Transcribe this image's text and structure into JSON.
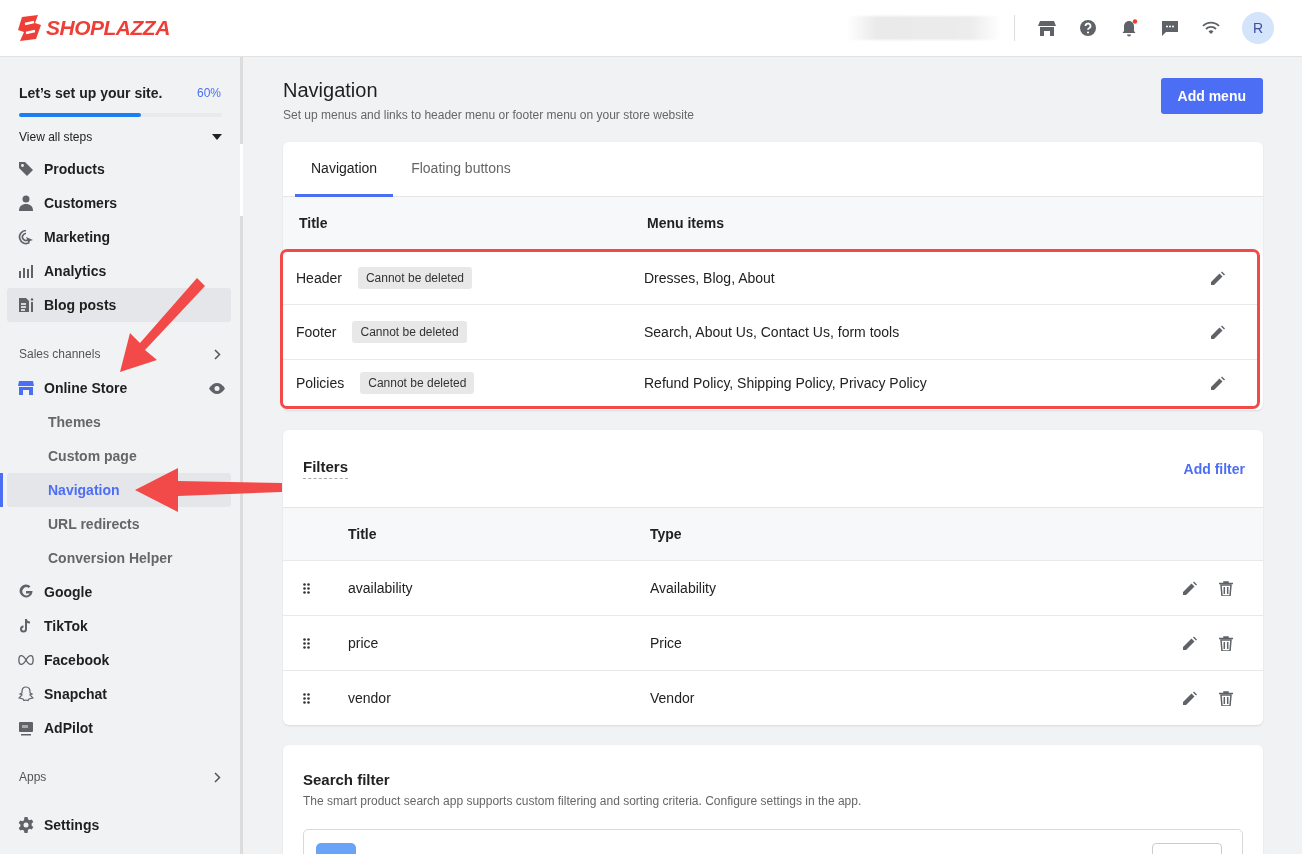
{
  "topbar": {
    "brand": "SHOPLAZZA",
    "notification_unread": true,
    "avatar": "R"
  },
  "sidebar": {
    "setup": {
      "title": "Let’s set up your site.",
      "percent": "60%",
      "level": 0.6,
      "toggle": "View all steps"
    },
    "items": [
      {
        "label": "Products",
        "kind": "main",
        "selected": false,
        "highlighted": false
      },
      {
        "label": "Customers",
        "kind": "main",
        "selected": false,
        "highlighted": false
      },
      {
        "label": "Marketing",
        "kind": "main",
        "selected": false,
        "highlighted": false
      },
      {
        "label": "Analytics",
        "kind": "main",
        "selected": false,
        "highlighted": false
      },
      {
        "label": "Blog posts",
        "kind": "main",
        "selected": false,
        "highlighted": true
      },
      {
        "label": "Sales channels",
        "kind": "section",
        "selected": false,
        "highlighted": false
      },
      {
        "label": "Online Store",
        "kind": "main",
        "selected": false,
        "highlighted": false
      },
      {
        "label": "Themes",
        "kind": "sub",
        "selected": false,
        "highlighted": false
      },
      {
        "label": "Custom page",
        "kind": "sub",
        "selected": false,
        "highlighted": false
      },
      {
        "label": "Navigation",
        "kind": "sub",
        "selected": true,
        "highlighted": true
      },
      {
        "label": "URL redirects",
        "kind": "sub",
        "selected": false,
        "highlighted": false
      },
      {
        "label": "Conversion Helper",
        "kind": "sub",
        "selected": false,
        "highlighted": false
      },
      {
        "label": "Google",
        "kind": "main",
        "selected": false,
        "highlighted": false
      },
      {
        "label": "TikTok",
        "kind": "main",
        "selected": false,
        "highlighted": false
      },
      {
        "label": "Facebook",
        "kind": "main",
        "selected": false,
        "highlighted": false
      },
      {
        "label": "Snapchat",
        "kind": "main",
        "selected": false,
        "highlighted": false
      },
      {
        "label": "AdPilot",
        "kind": "main",
        "selected": false,
        "highlighted": false
      },
      {
        "label": "Apps",
        "kind": "section",
        "selected": false,
        "highlighted": false
      },
      {
        "label": "Settings",
        "kind": "main",
        "selected": false,
        "highlighted": false
      }
    ]
  },
  "page": {
    "title": "Navigation",
    "subtitle": "Set up menus and links to header menu or footer menu on your store website",
    "primary_button": "Add menu"
  },
  "navigation_card": {
    "tabs": [
      {
        "label": "Navigation",
        "selected": true
      },
      {
        "label": "Floating buttons",
        "selected": false
      }
    ],
    "columns": [
      "Title",
      "Menu items"
    ],
    "rows": [
      {
        "title": "Header",
        "badge": "Cannot be deleted",
        "menu_items": "Dresses, Blog, About"
      },
      {
        "title": "Footer",
        "badge": "Cannot be deleted",
        "menu_items": "Search, About Us, Contact Us, form tools"
      },
      {
        "title": "Policies",
        "badge": "Cannot be deleted",
        "menu_items": "Refund Policy, Shipping Policy, Privacy Policy"
      }
    ]
  },
  "filters_card": {
    "title": "Filters",
    "action": "Add filter",
    "columns": [
      "Title",
      "Type"
    ],
    "rows": [
      {
        "title": "availability",
        "type": "Availability"
      },
      {
        "title": "price",
        "type": "Price"
      },
      {
        "title": "vendor",
        "type": "Vendor"
      }
    ]
  },
  "search_filter_card": {
    "title": "Search filter",
    "description": "The smart product search app supports custom filtering and sorting criteria. Configure settings in the app."
  }
}
